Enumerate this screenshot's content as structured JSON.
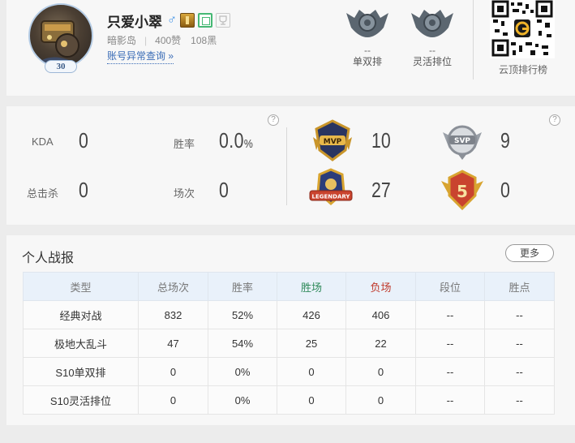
{
  "profile": {
    "name": "只爱小翠",
    "gender_symbol": "♂",
    "level": "30",
    "server": "暗影岛",
    "likes": "400赞",
    "blacks": "108黑",
    "report_link": "账号异常查询 »"
  },
  "ranks": [
    {
      "value": "--",
      "label": "单双排"
    },
    {
      "value": "--",
      "label": "灵活排位"
    }
  ],
  "qr": {
    "label": "云顶排行榜"
  },
  "stats": {
    "kda_label": "KDA",
    "kda_value": "0",
    "winrate_label": "胜率",
    "winrate_value": "0.0",
    "winrate_unit": "%",
    "kills_label": "总击杀",
    "kills_value": "0",
    "games_label": "场次",
    "games_value": "0",
    "help_glyph": "?"
  },
  "honors": [
    {
      "name": "MVP",
      "count": "10",
      "color": "#d8a430"
    },
    {
      "name": "SVP",
      "count": "9",
      "color": "#b9bcc2"
    },
    {
      "name": "LEGENDARY",
      "count": "27",
      "color": "#d8a430"
    },
    {
      "name": "5",
      "count": "0",
      "color": "#c9432e"
    }
  ],
  "records": {
    "title": "个人战报",
    "more_label": "更多",
    "headers": [
      "类型",
      "总场次",
      "胜率",
      "胜场",
      "负场",
      "段位",
      "胜点"
    ],
    "rows": [
      [
        "经典对战",
        "832",
        "52%",
        "426",
        "406",
        "--",
        "--"
      ],
      [
        "极地大乱斗",
        "47",
        "54%",
        "25",
        "22",
        "--",
        "--"
      ],
      [
        "S10单双排",
        "0",
        "0%",
        "0",
        "0",
        "--",
        "--"
      ],
      [
        "S10灵活排位",
        "0",
        "0%",
        "0",
        "0",
        "--",
        "--"
      ]
    ]
  },
  "colors": {
    "accent_blue": "#3a6cb6",
    "win_green": "#2f8a5a",
    "loss_red": "#c0392b",
    "header_bg": "#e9f1fa"
  }
}
